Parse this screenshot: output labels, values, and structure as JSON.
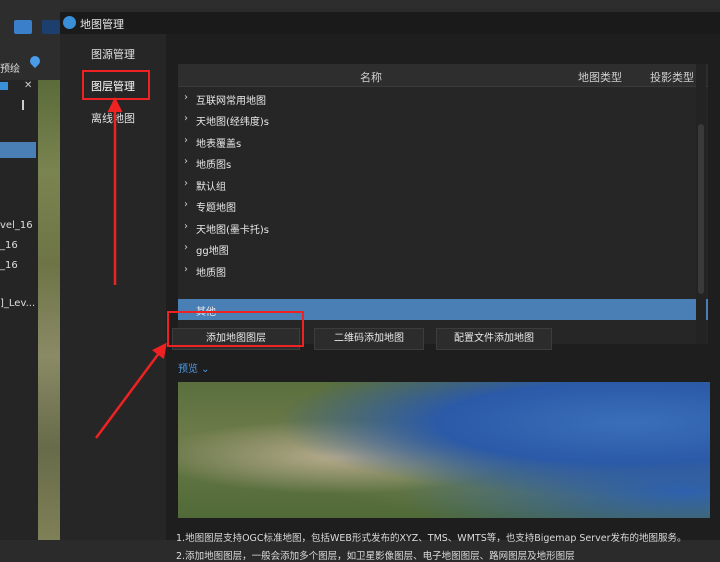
{
  "app": {
    "toolbar_partial_label": "预绘",
    "panel_rows": [
      "vel_16",
      "_16",
      "_16",
      "]_Lev..."
    ],
    "close_glyph": "✕"
  },
  "dialog": {
    "title": "地图管理",
    "nav": [
      "图源管理",
      "图层管理",
      "离线地图"
    ],
    "active_nav": "图层管理"
  },
  "grid": {
    "columns": [
      "名称",
      "地图类型",
      "投影类型"
    ],
    "rows": [
      "互联网常用地图",
      "天地图(经纬度)s",
      "地表覆盖s",
      "地质图s",
      "默认组",
      "专题地图",
      "天地图(墨卡托)s",
      "gg地图",
      "地质图",
      "其他"
    ],
    "selected_row": "其他"
  },
  "buttons": {
    "add_layer": "添加地图图层",
    "qr_add": "二维码添加地图",
    "config_add": "配置文件添加地图"
  },
  "preview": {
    "label": "预览 ⌄"
  },
  "footer": {
    "line1": "1.地图图层支持OGC标准地图，包括WEB形式发布的XYZ、TMS、WMTS等，也支持Bigemap Server发布的地图服务。",
    "line2": "2.添加地图图层，一般会添加多个图层，如卫星影像图层、电子地图图层、路网图层及地形图层"
  },
  "colors": {
    "accent": "#4a7fb5",
    "highlight": "#e22222",
    "link": "#4c9be8"
  }
}
